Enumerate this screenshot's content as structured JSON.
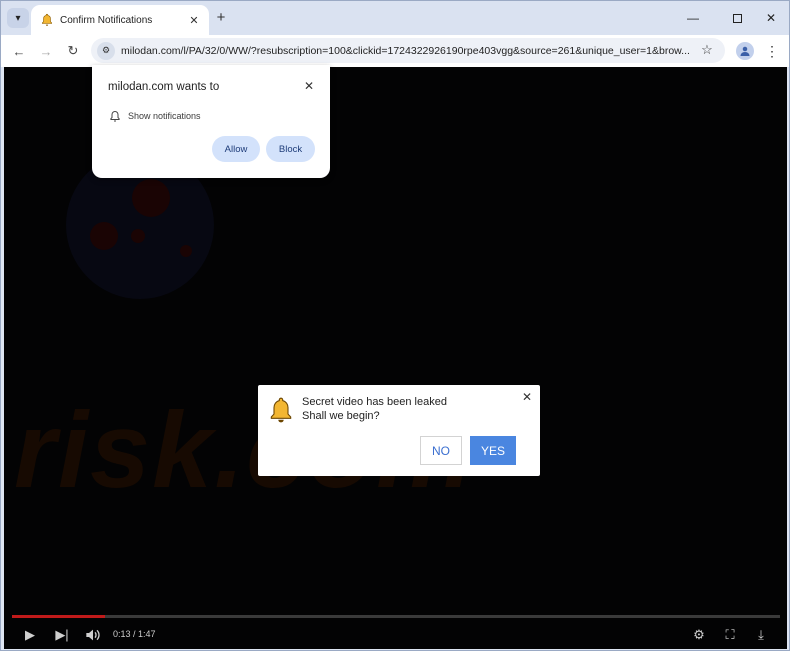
{
  "tab": {
    "title": "Confirm Notifications"
  },
  "toolbar": {
    "url": "milodan.com/l/PA/32/0/WW/?resubscription=100&clickid=1724322926190rpe403vgg&source=261&unique_user=1&brow..."
  },
  "permission_popup": {
    "title": "milodan.com wants to",
    "permission_label": "Show notifications",
    "allow_label": "Allow",
    "block_label": "Block"
  },
  "dialog": {
    "line1": "Secret video has been leaked",
    "line2": "Shall we begin?",
    "no_label": "NO",
    "yes_label": "YES"
  },
  "video": {
    "time": "0:13 / 1:47",
    "progress_fraction": 0.121
  },
  "watermark": {
    "text": "risk.com"
  },
  "colors": {
    "accent": "#4a86e0",
    "permission_button": "#d3e2fb",
    "page_background": "#030304",
    "progress_played": "#c01a1a"
  },
  "icons": {
    "tab_search": "chevron-down-icon",
    "tab_favicon": "bell-icon",
    "new_tab": "plus-icon",
    "back": "arrow-left-icon",
    "forward": "arrow-right-icon",
    "reload": "reload-icon",
    "site_info": "tune-icon",
    "bookmark": "star-icon",
    "profile": "person-icon",
    "menu": "kebab-menu-icon",
    "play": "play-icon",
    "next": "skip-next-icon",
    "volume": "volume-icon",
    "settings": "gear-icon",
    "fullscreen": "fullscreen-icon",
    "download": "download-icon"
  }
}
